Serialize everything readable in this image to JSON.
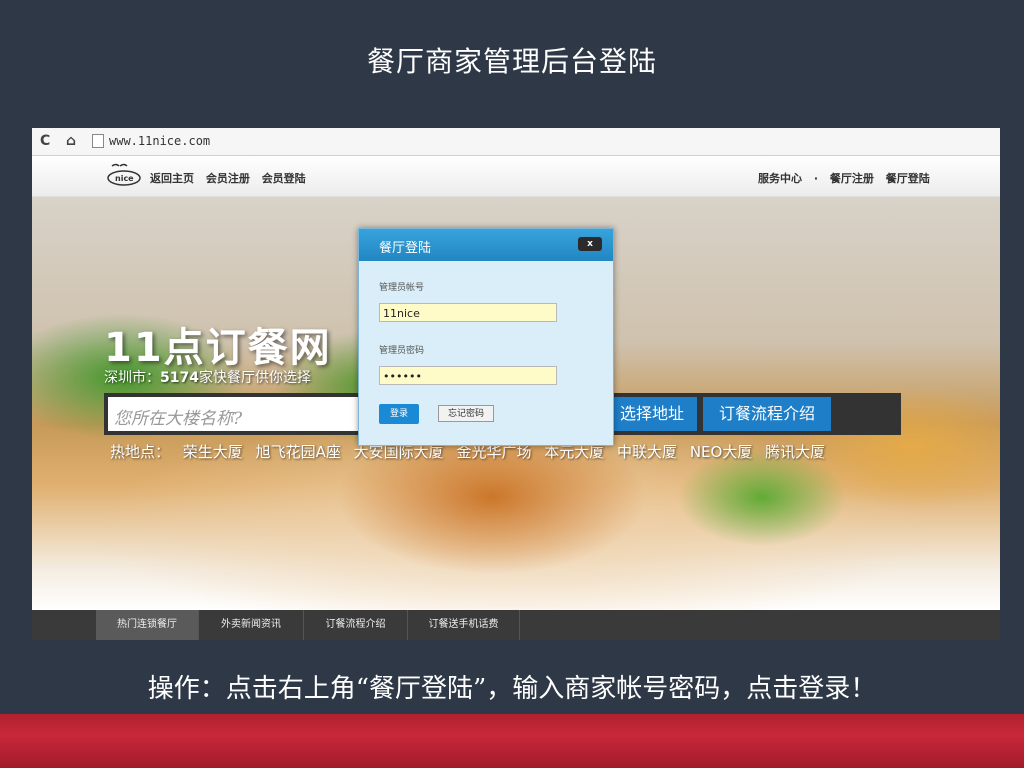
{
  "slide": {
    "title": "餐厅商家管理后台登陆",
    "instruction": "操作：点击右上角“餐厅登陆”，输入商家帐号密码，点击登录！"
  },
  "browser": {
    "reload_icon": "C",
    "home_icon": "⌂",
    "url": "www.11nice.com"
  },
  "site": {
    "logo_text": "nice",
    "nav_left": [
      "返回主页",
      "会员注册",
      "会员登陆"
    ],
    "nav_right": [
      "服务中心",
      "·",
      "餐厅注册",
      "餐厅登陆"
    ]
  },
  "hero": {
    "title": "11点订餐网",
    "subtitle_prefix": "深圳市：",
    "subtitle_count": "5174",
    "subtitle_suffix": "家快餐厅供你选择",
    "search_placeholder": "您所在大楼名称?",
    "select_address": "选择地址",
    "order_process": "订餐流程介绍",
    "hot_label": "热地点：",
    "hot_spots": [
      "荣生大厦",
      "旭飞花园A座",
      "大安国际大厦",
      "金光华广场",
      "本元大厦",
      "中联大厦",
      "NEO大厦",
      "腾讯大厦"
    ]
  },
  "tabs": [
    "热门连锁餐厅",
    "外卖新闻资讯",
    "订餐流程介绍",
    "订餐送手机话费"
  ],
  "dialog": {
    "title": "餐厅登陆",
    "close": "x",
    "account_label": "管理员帐号",
    "account_value": "11nice",
    "password_label": "管理员密码",
    "password_value": "••••••",
    "login_button": "登录",
    "forgot_button": "忘记密码"
  },
  "colors": {
    "background": "#2e3846",
    "dialog_header": "#2186c2",
    "search_button": "#1e7ec8",
    "bottom_band": "#c8283a"
  }
}
